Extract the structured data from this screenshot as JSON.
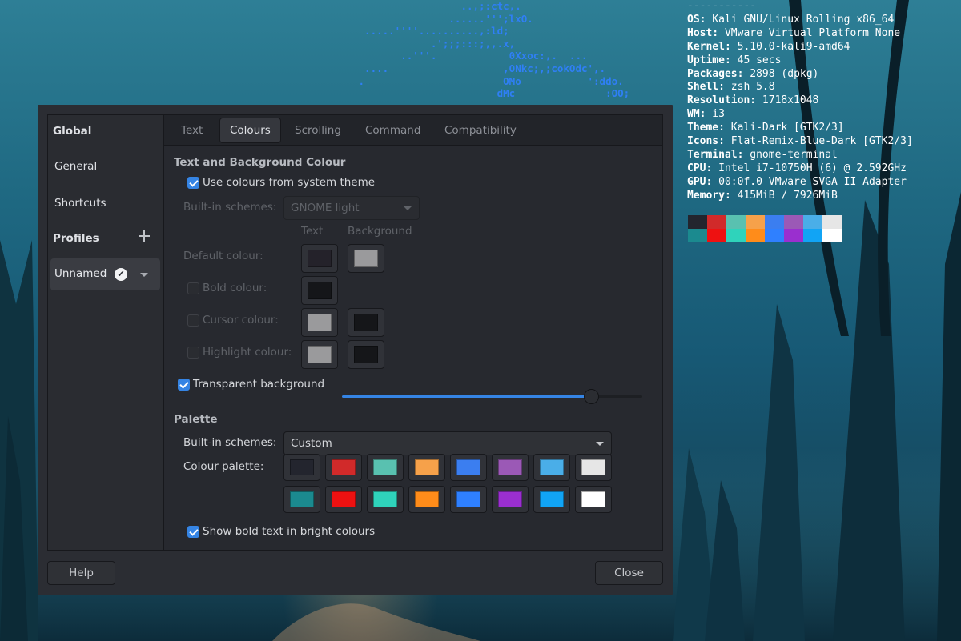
{
  "neofetch": {
    "ascii_lines": [
      "                  ..,;:ctc,.",
      "                ......''';lxO.",
      "  .....''''..........,:ld;",
      "             .';;;:::;,,.x,",
      "        ..'''.            0Xxoc:,.  ...",
      "  ....                   ,ONkc;,;cokOdc',.",
      " .                       OMo           ':ddo.",
      "                        dMc               :OO;"
    ],
    "separator": "-----------",
    "info": [
      {
        "key": "OS:",
        "value": " Kali GNU/Linux Rolling x86_64"
      },
      {
        "key": "Host:",
        "value": " VMware Virtual Platform None"
      },
      {
        "key": "Kernel:",
        "value": " 5.10.0-kali9-amd64"
      },
      {
        "key": "Uptime:",
        "value": " 45 secs"
      },
      {
        "key": "Packages:",
        "value": " 2898 (dpkg)"
      },
      {
        "key": "Shell:",
        "value": " zsh 5.8"
      },
      {
        "key": "Resolution:",
        "value": " 1718x1048"
      },
      {
        "key": "WM:",
        "value": " i3"
      },
      {
        "key": "Theme:",
        "value": " Kali-Dark [GTK2/3]"
      },
      {
        "key": "Icons:",
        "value": " Flat-Remix-Blue-Dark [GTK2/3]"
      },
      {
        "key": "Terminal:",
        "value": " gnome-terminal"
      },
      {
        "key": "CPU:",
        "value": " Intel i7-10750H (6) @ 2.592GHz"
      },
      {
        "key": "GPU:",
        "value": " 00:0f.0 VMware SVGA II Adapter"
      },
      {
        "key": "Memory:",
        "value": " 415MiB / 7926MiB"
      }
    ],
    "swatch_colors": [
      "#23252e",
      "#d12a2a",
      "#59c1b0",
      "#f6a14a",
      "#3b7ef0",
      "#9b59b6",
      "#4aaee8",
      "#e6e6e6",
      "#1b8a8f",
      "#ee1111",
      "#2fd3bb",
      "#ff8c1a",
      "#2f80ff",
      "#9a2fcf",
      "#11a4f5",
      "#ffffff"
    ]
  },
  "sidebar": {
    "global_heading": "Global",
    "general": "General",
    "shortcuts": "Shortcuts",
    "profiles_heading": "Profiles",
    "profile_name": "Unnamed",
    "default_mark": "✔"
  },
  "tabs": [
    "Text",
    "Colours",
    "Scrolling",
    "Command",
    "Compatibility"
  ],
  "active_tab": "Colours",
  "colours": {
    "section_title": "Text and Background Colour",
    "use_system_theme": {
      "label": "Use colours from system theme",
      "checked": true
    },
    "builtin_label": "Built-in schemes:",
    "builtin_value": "GNOME light",
    "col_text": "Text",
    "col_background": "Background",
    "default_colour": {
      "label": "Default colour:",
      "text": "#24222a",
      "background": "#9a9a9c"
    },
    "bold_colour": {
      "label": "Bold colour:",
      "checked": false,
      "text": "#151619"
    },
    "cursor_colour": {
      "label": "Cursor colour:",
      "checked": false,
      "text": "#9a9a9c",
      "background": "#151619"
    },
    "highlight_colour": {
      "label": "Highlight colour:",
      "checked": false,
      "text": "#9a9a9c",
      "background": "#151619"
    },
    "transparent": {
      "label": "Transparent background",
      "checked": true,
      "level_percent": 83
    }
  },
  "palette": {
    "section_title": "Palette",
    "builtin_label": "Built-in schemes:",
    "builtin_value": "Custom",
    "palette_label": "Colour palette:",
    "row1": [
      "#23252e",
      "#d12a2a",
      "#59c1b0",
      "#f6a14a",
      "#3b7ef0",
      "#9b59b6",
      "#4aaee8",
      "#e6e6e6"
    ],
    "row2": [
      "#1b8a8f",
      "#ee1111",
      "#2fd3bb",
      "#ff8c1a",
      "#2f80ff",
      "#9a2fcf",
      "#11a4f5",
      "#ffffff"
    ],
    "bold_bright": {
      "label": "Show bold text in bright colours",
      "checked": true
    }
  },
  "buttons": {
    "help": "Help",
    "close": "Close"
  },
  "accent": "#3584e4"
}
